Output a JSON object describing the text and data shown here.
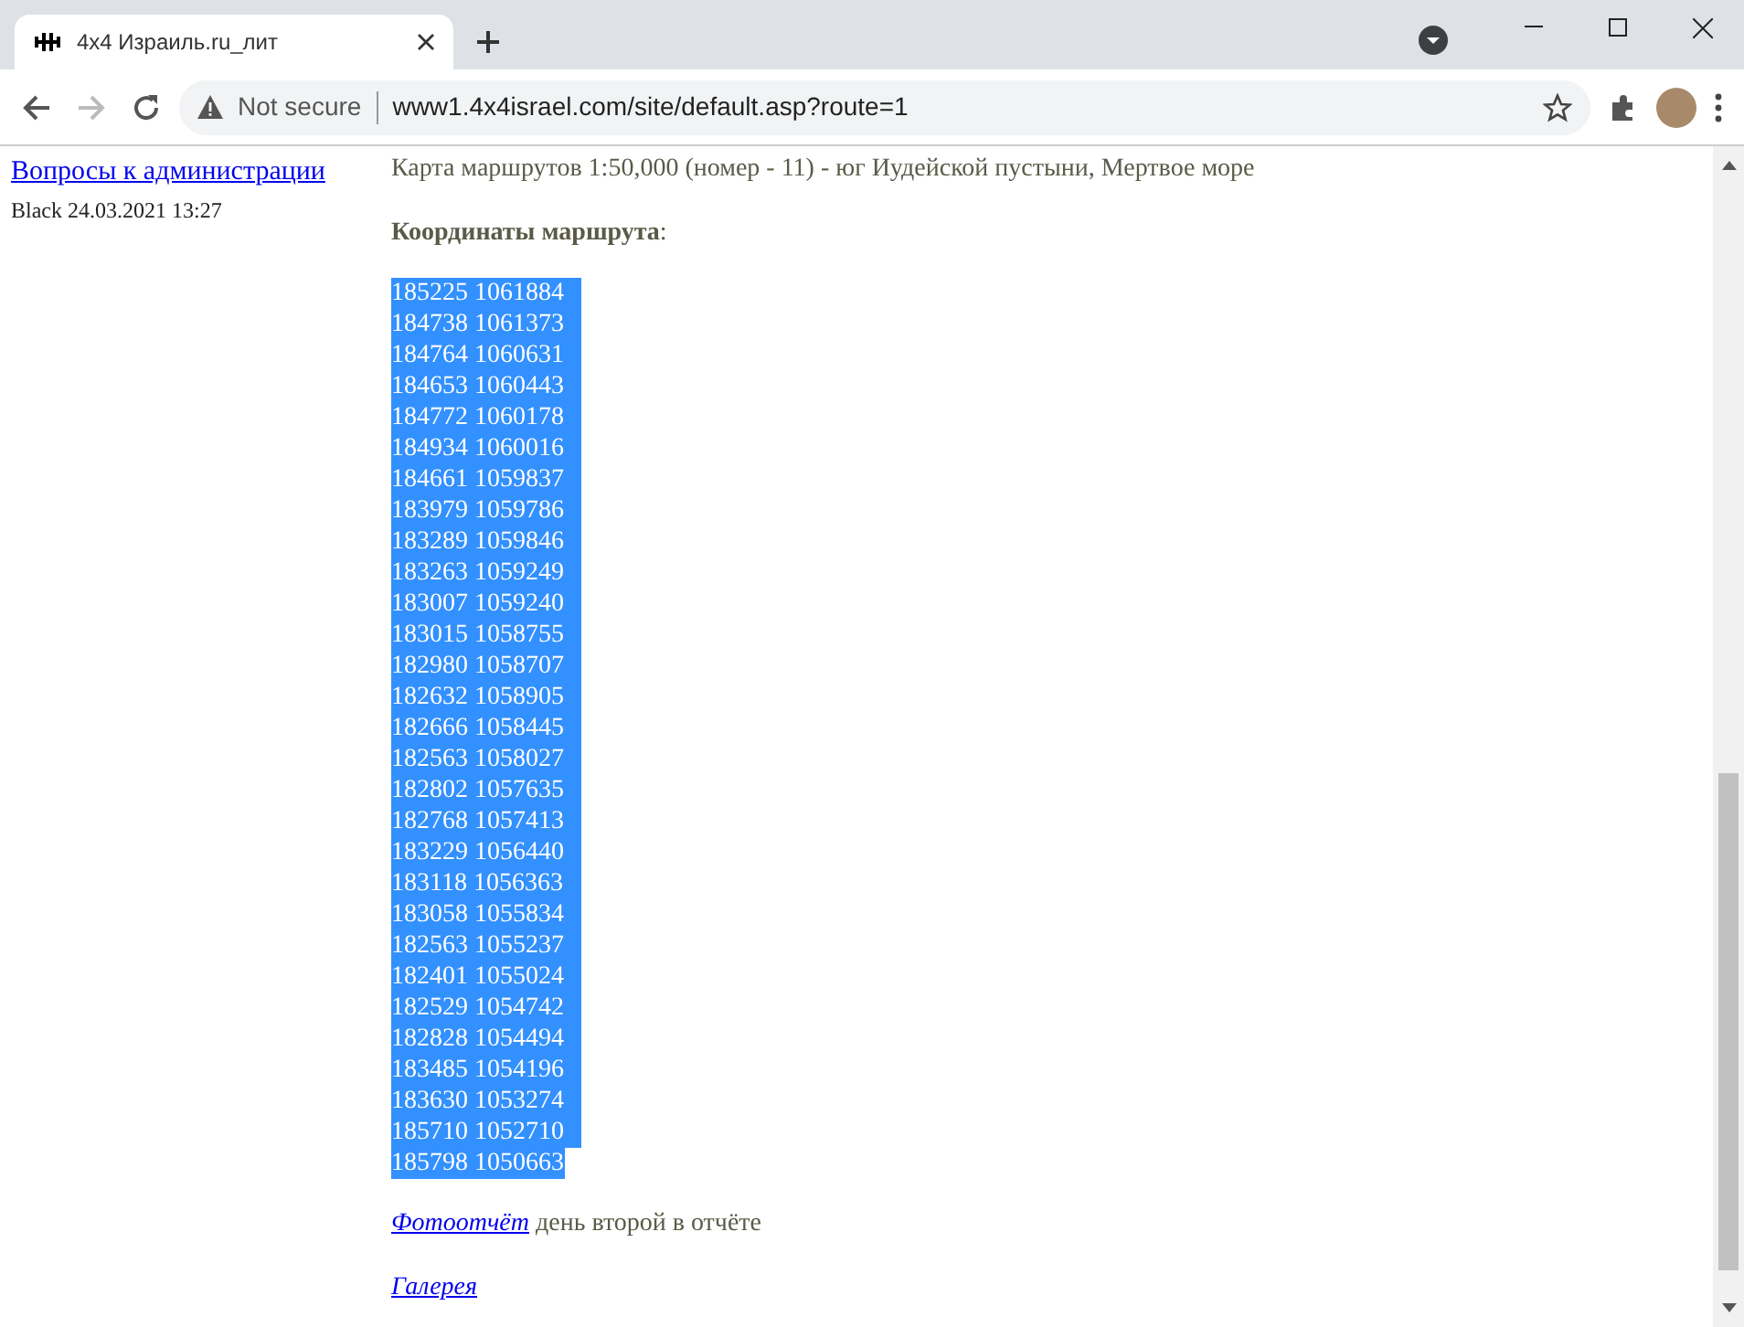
{
  "browser": {
    "tab_title": "4x4 Израиль.ru_лит",
    "security": "Not secure",
    "url": "www1.4x4israel.com/site/default.asp?route=1"
  },
  "sidebar": {
    "link": "Вопросы к администрации",
    "byline": "Black 24.03.2021 13:27"
  },
  "content": {
    "map_line": "Карта маршрутов 1:50,000 (номер - 11) - юг Иудейской пустыни, Мертвое море",
    "coordinates_heading": "**Координаты маршрута**:",
    "coordinates": {
      "selected": true,
      "lines": [
        "185225 1061884",
        "184738 1061373",
        "184764 1060631",
        "184653 1060443",
        "184772 1060178",
        "184934 1060016",
        "184661 1059837",
        "183979 1059786",
        "183289 1059846",
        "183263 1059249",
        "183007 1059240",
        "183015 1058755",
        "182980 1058707",
        "182632 1058905",
        "182666 1058445",
        "182563 1058027",
        "182802 1057635",
        "182768 1057413",
        "183229 1056440",
        "183118 1056363",
        "183058 1055834",
        "182563 1055237",
        "182401 1055024",
        "182529 1054742",
        "182828 1054494",
        "183485 1054196",
        "183630 1053274",
        "185710 1052710",
        "185798 1050663"
      ]
    },
    "photo_report": {
      "link": "Фотоотчёт",
      "text": "день второй в отчёте"
    },
    "gallery_link": "Галерея"
  }
}
